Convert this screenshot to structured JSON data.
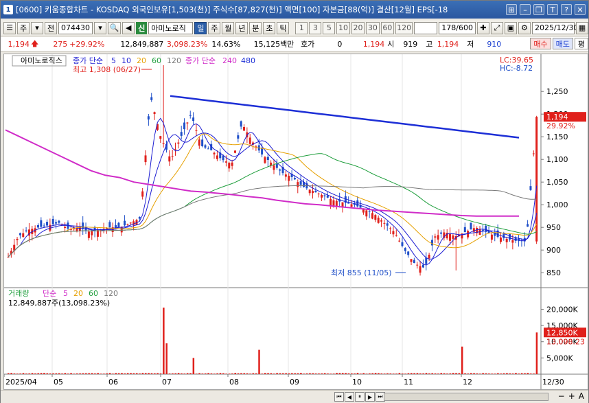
{
  "window": {
    "number": "1",
    "title": "[0600] 키움종합차트 - KOSDAQ 외국인보유[1,503(천)] 주식수[87,827(천)] 액면[100] 자본금[88(억)] 결산[12월] EPS[-18"
  },
  "toolbar": {
    "type_select": "주",
    "prev_label": "전",
    "code": "074430",
    "new_label": "신",
    "stock_name": "아미노로직",
    "periods": [
      "일",
      "주",
      "월",
      "년",
      "분",
      "초",
      "틱"
    ],
    "active_period": "일",
    "intervals": [
      "1",
      "3",
      "5",
      "10",
      "20",
      "30",
      "60",
      "120"
    ],
    "count": "178/600",
    "date": "2025/12/30"
  },
  "quote": {
    "price": "1,194",
    "change": "275",
    "change_pct": "+29.92%",
    "volume": "12,849,887",
    "volume_pct": "3,098.23%",
    "turnover": "14.63%",
    "amount": "15,125백만",
    "hoga_label": "호가",
    "hoga": "0",
    "bid": "1,194",
    "open_label": "시",
    "open": "919",
    "high_label": "고",
    "high": "1,194",
    "low_label": "저",
    "low": "910",
    "buy_label": "매수",
    "sell_label": "매도",
    "eval_label": "평"
  },
  "legend": {
    "stock_name": "아미노로직스",
    "ma_label": "종가 단순",
    "ma_periods": [
      "5",
      "10",
      "20",
      "60",
      "120"
    ],
    "ma2_label": "종가 단순",
    "ma2_periods": [
      "240",
      "480"
    ],
    "high_note": "최고 1,308 (06/27)",
    "low_note": "최저 855 (11/05)",
    "lc": "LC:39.65",
    "hc": "HC:-8.72",
    "current_price": "1,194",
    "current_pct": "29.92%"
  },
  "volume_panel": {
    "label": "거래량",
    "ma_label": "단순",
    "periods": [
      "5",
      "20",
      "60",
      "120"
    ],
    "value": "12,849,887주(13,098.23%)",
    "current": "12,850K",
    "current_pct": "13,098.23"
  },
  "colors": {
    "ma5": "#1e1ed2",
    "ma10": "#1e1ed2",
    "ma20": "#e6a000",
    "ma60": "#1e9e3c",
    "ma120": "#777777",
    "ma240": "#d02cc8",
    "ma480": "#1d2fd6",
    "up": "#e0201b",
    "down": "#1f4fc8"
  },
  "chart_data": {
    "type": "line",
    "title": "",
    "y_axis_ticks": [
      850,
      900,
      950,
      1000,
      1050,
      1100,
      1150,
      1200,
      1250
    ],
    "y_axis_labels": [
      "850",
      "900",
      "950",
      "1,000",
      "1,050",
      "1,100",
      "1,150",
      "1,200",
      "1,250"
    ],
    "x_axis_labels": [
      "2025/04",
      "05",
      "06",
      "07",
      "08",
      "09",
      "10",
      "11",
      "12",
      "12/30"
    ],
    "ylim": [
      820,
      1320
    ],
    "volume_ticks_labels": [
      "5,000K",
      "10,000K",
      "15,000K",
      "20,000K"
    ],
    "volume_ticks": [
      5000,
      10000,
      15000,
      20000
    ],
    "series": [
      {
        "name": "종가",
        "values": [
          885,
          930,
          945,
          950,
          955,
          960,
          945,
          950,
          940,
          945,
          950,
          950,
          960,
          970,
          1240,
          1150,
          1100,
          1150,
          1200,
          1130,
          1120,
          1100,
          1090,
          1180,
          1140,
          1110,
          1090,
          1070,
          1060,
          1040,
          1030,
          1020,
          1010,
          1005,
          1000,
          990,
          980,
          960,
          940,
          900,
          870,
          860,
          930,
          940,
          930,
          940,
          950,
          940,
          930,
          925,
          920,
          919,
          1194
        ]
      },
      {
        "name": "240",
        "values": [
          1165,
          1150,
          1135,
          1120,
          1105,
          1090,
          1075,
          1065,
          1060,
          1050,
          1045,
          1040,
          1035,
          1030,
          1028,
          1025,
          1022,
          1018,
          1015,
          1010,
          1006,
          1002,
          1000,
          997,
          994,
          991,
          988,
          986,
          984,
          982,
          980,
          978,
          976,
          975,
          975,
          975,
          975
        ]
      },
      {
        "name": "480",
        "values": [
          1240,
          1236,
          1232,
          1228,
          1224,
          1220,
          1216,
          1212,
          1208,
          1204,
          1200,
          1196,
          1192,
          1188,
          1184,
          1180,
          1176,
          1172,
          1168,
          1164,
          1160,
          1156,
          1152,
          1148
        ]
      }
    ],
    "high": {
      "value": 1308,
      "date": "06/27"
    },
    "low": {
      "value": 855,
      "date": "11/05"
    },
    "last_close": 1194,
    "last_volume_k": 12850
  }
}
